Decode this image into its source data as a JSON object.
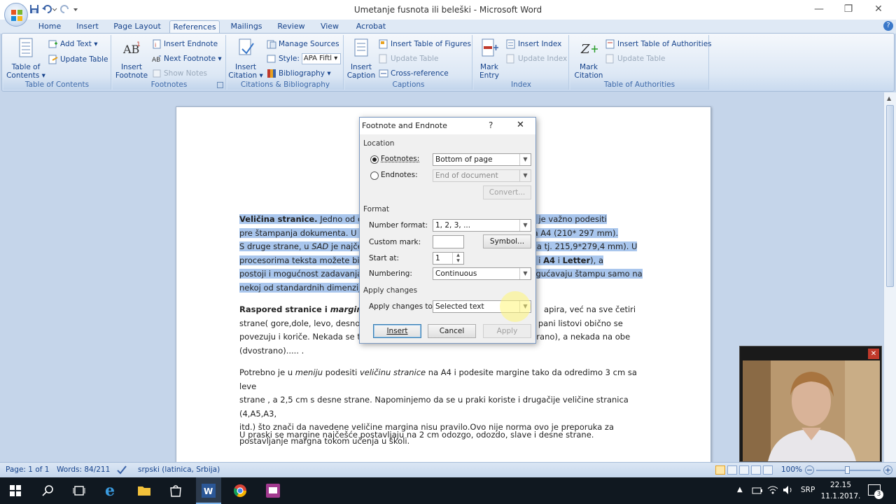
{
  "window": {
    "title": "Umetanje fusnota ili beleški - Microsoft Word"
  },
  "tabs": [
    "Home",
    "Insert",
    "Page Layout",
    "References",
    "Mailings",
    "Review",
    "View",
    "Acrobat"
  ],
  "active_tab": "References",
  "ribbon": {
    "toc": {
      "big": "Table of Contents",
      "big_l1": "Table of",
      "big_l2": "Contents ▾",
      "add_text": "Add Text ▾",
      "update_table": "Update Table",
      "label": "Table of Contents"
    },
    "footnotes": {
      "big_l1": "Insert",
      "big_l2": "Footnote",
      "insert_endnote": "Insert Endnote",
      "next_footnote": "Next Footnote ▾",
      "show_notes": "Show Notes",
      "label": "Footnotes"
    },
    "citations": {
      "big_l1": "Insert",
      "big_l2": "Citation ▾",
      "manage_sources": "Manage Sources",
      "style_label": "Style:",
      "style_value": "APA Fiftl",
      "bibliography": "Bibliography ▾",
      "label": "Citations & Bibliography"
    },
    "captions": {
      "big_l1": "Insert",
      "big_l2": "Caption",
      "insert_tof": "Insert Table of Figures",
      "update_table": "Update Table",
      "cross_reference": "Cross-reference",
      "label": "Captions"
    },
    "index": {
      "big_l1": "Mark",
      "big_l2": "Entry",
      "insert_index": "Insert Index",
      "update_index": "Update Index",
      "label": "Index"
    },
    "toa": {
      "big_l1": "Mark",
      "big_l2": "Citation",
      "insert_toa": "Insert Table of Authorities",
      "update_table": "Update Table",
      "label": "Table of Authorities"
    }
  },
  "document": {
    "p1": {
      "bold": "Veličina stranice.",
      "l1_a": " Jedno od osn",
      "l1_b": "Veličinu je važno podesiti",
      "l2_a": "pre štampanja dokumenta. U ",
      "l2_b": "formata A4 (210*  297 mm).",
      "l3_a": "S druge strane, u ",
      "l3_sad": "SAD",
      "l3_b": " je najčešć",
      "l3_c": "inča tj. 215,9*279,4  mm). U",
      "l4_a": "procesorima teksta možete bir",
      "l4_b": "ljučujući i ",
      "l4_a4": "A4",
      "l4_i": " i ",
      "l4_letter": "Letter",
      "l4_c": "), a",
      "l5_a": "postoji i mogućnost zadavanja",
      "l5_b": "mogućavaju štampu samo na",
      "l6": "nekoj od standardnih dimenzij"
    },
    "p2": {
      "bold": "Raspored stranice i ",
      "bold_italic": "margine.",
      "l1_a": "S",
      "l1_b": "apira, već na sve četiri",
      "l2_a": "strane( gore,dole, levo, desno)",
      "l2_b": "pani listovi obično se",
      "l3_a": "povezuju i koriče. Nekada se te",
      "l3_b": "vostrano), a nekada na obe",
      "l4": "(dvostrano)..... ."
    },
    "p3": {
      "l1_a": "Potrebno je u ",
      "l1_menu": "meniju",
      "l1_b": " podesiti ",
      "l1_vel": "veličinu stranice",
      "l1_c": "  na A4  i podesite margine tako da odredimo 3 cm sa leve",
      "l2": "strane , a 2,5 cm  s desne strane. Napominjemo da se u praki koriste i drugačije veličine stranica (4,A5,A3,",
      "l3": "itd.) što znači da navedene veličine margina nisu pravilo.Ovo nije norma ovo je preporuka za",
      "l4": "postavljanje margna tokom učenja u školi."
    },
    "p4": "U praski se margine najčešće postavljaju na 2 cm odozgo, odozdo, slave i desne strane."
  },
  "dialog": {
    "title": "Footnote and Endnote",
    "help": "?",
    "close": "✕",
    "location_label": "Location",
    "footnotes_label": "Footnotes:",
    "footnotes_value": "Bottom of page",
    "footnotes_selected": true,
    "endnotes_label": "Endnotes:",
    "endnotes_value": "End of document",
    "convert": "Convert...",
    "format_label": "Format",
    "number_format_label": "Number format:",
    "number_format_value": "1, 2, 3, ...",
    "custom_mark_label": "Custom mark:",
    "custom_mark_value": "",
    "symbol": "Symbol...",
    "start_at_label": "Start at:",
    "start_at_value": "1",
    "numbering_label": "Numbering:",
    "numbering_value": "Continuous",
    "apply_changes_section": "Apply changes",
    "apply_changes_to_label": "Apply changes to:",
    "apply_changes_to_value": "Selected text",
    "insert": "Insert",
    "cancel": "Cancel",
    "apply": "Apply"
  },
  "status": {
    "page": "Page: 1 of 1",
    "words": "Words: 84/211",
    "language": "srpski (latinica, Srbija)",
    "zoom": "100%"
  },
  "taskbar": {
    "lang": "SRP",
    "time": "22.15",
    "date": "11.1.2017.",
    "notifications": "3"
  },
  "webcam": {
    "close": "✕"
  }
}
